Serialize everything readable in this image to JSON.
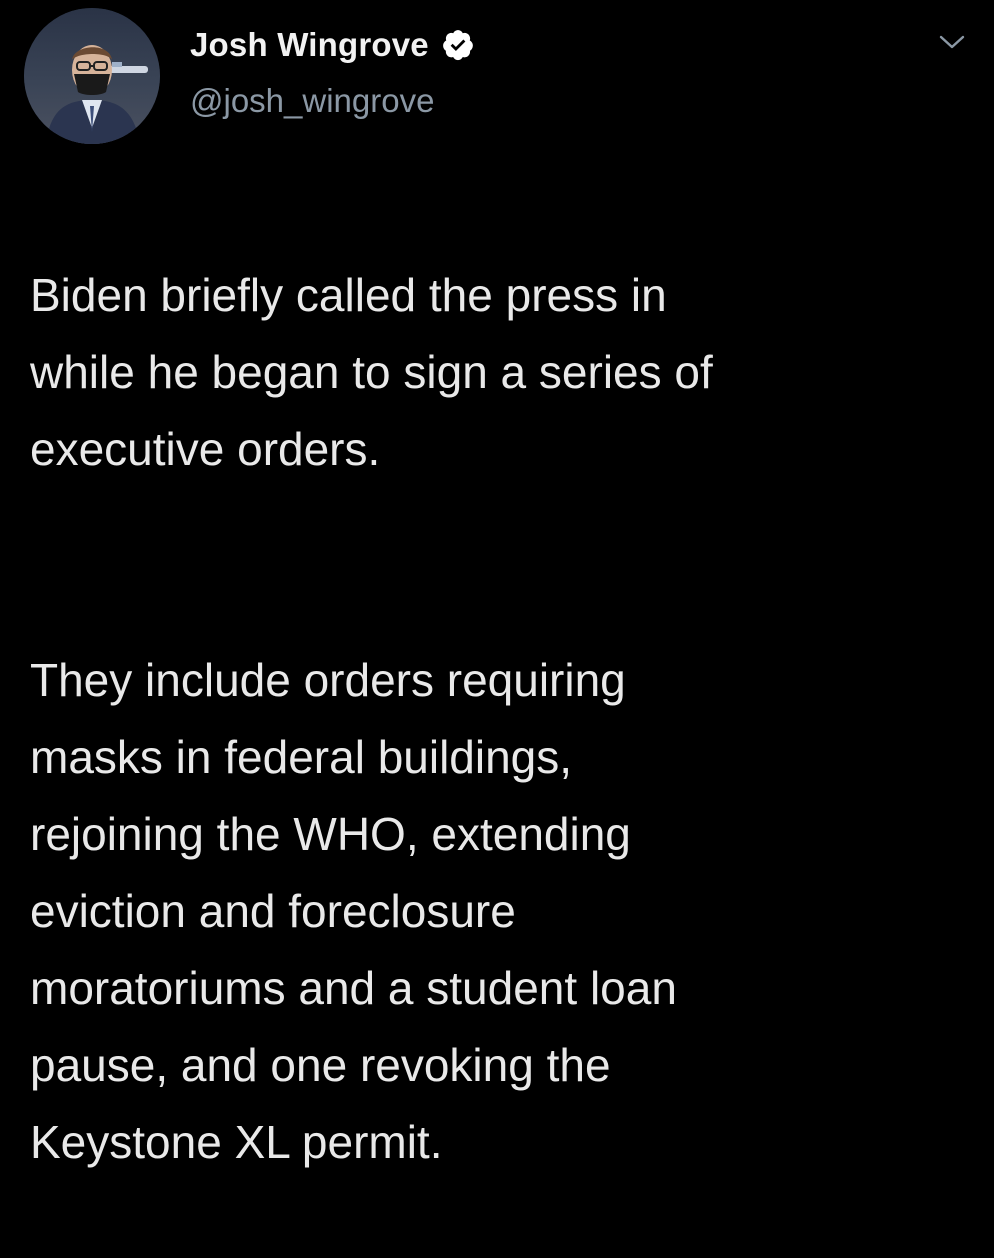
{
  "author": {
    "display_name": "Josh Wingrove",
    "handle": "@josh_wingrove",
    "verified_icon": "verified-badge-icon",
    "avatar_icon": "profile-photo"
  },
  "tweet": {
    "paragraph_1": "Biden briefly called the press in\nwhile he began to sign a series of\nexecutive orders.",
    "paragraph_2": "They include orders requiring\nmasks in federal buildings,\nrejoining the WHO, extending\neviction and foreclosure\nmoratoriums and a student loan\npause, and one revoking the\nKeystone XL permit."
  },
  "menu": {
    "icon": "chevron-down-icon"
  },
  "colors": {
    "background": "#000000",
    "text": "#e9e9e9",
    "handle": "#8b98a5",
    "verified_badge": "#ffffff"
  }
}
